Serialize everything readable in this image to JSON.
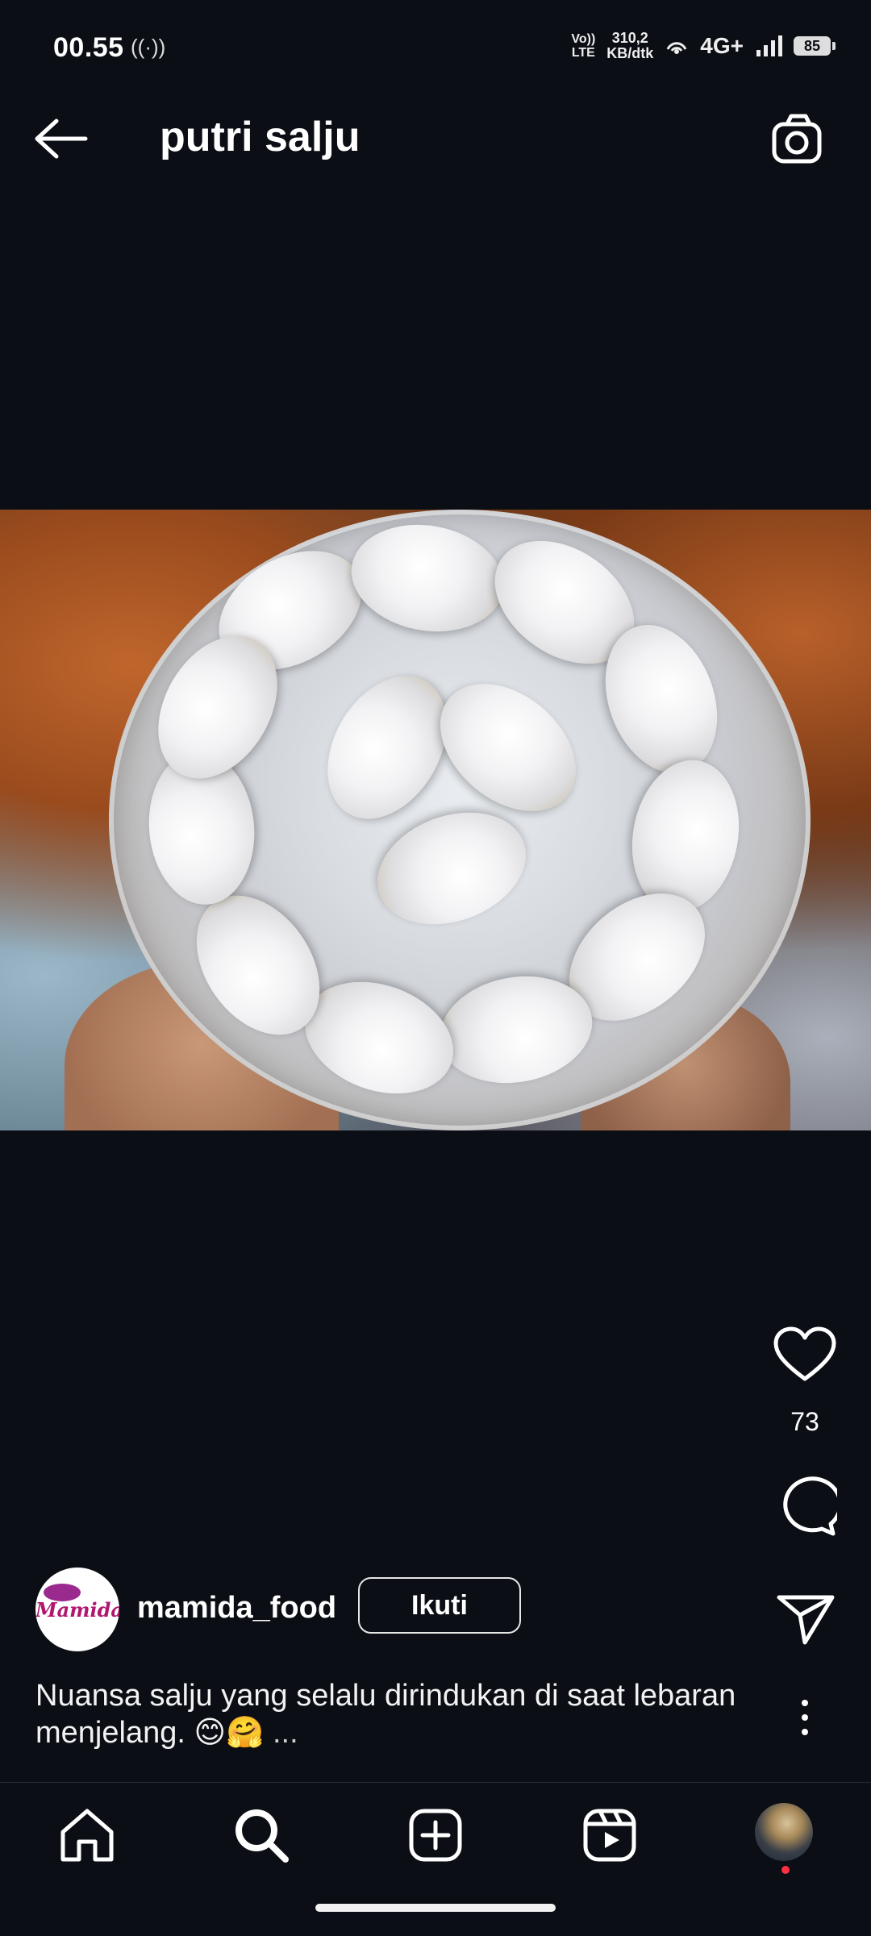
{
  "status_bar": {
    "time": "00.55",
    "radio_icon": "((·))",
    "volte": "Vo))\nLTE",
    "speed": "310,2\nKB/dtk",
    "network": "4G+",
    "battery": "85"
  },
  "header": {
    "title": "putri salju"
  },
  "post": {
    "username": "mamida_food",
    "follow_label": "Ikuti",
    "avatar_text": "Mamida",
    "likes": "73",
    "caption": "Nuansa salju yang selalu dirindukan di saat lebaran menjelang. 😊🤗",
    "caption_more": " ..."
  },
  "colors": {
    "background": "#0b0e14",
    "notification_dot": "#ff3040"
  },
  "icons": {
    "back": "arrow-left-icon",
    "camera": "camera-icon",
    "like": "heart-icon",
    "comment": "comment-icon",
    "share": "send-icon",
    "more": "more-vertical-icon",
    "nav": [
      "home-icon",
      "search-icon",
      "add-icon",
      "reels-icon",
      "profile-avatar"
    ]
  }
}
